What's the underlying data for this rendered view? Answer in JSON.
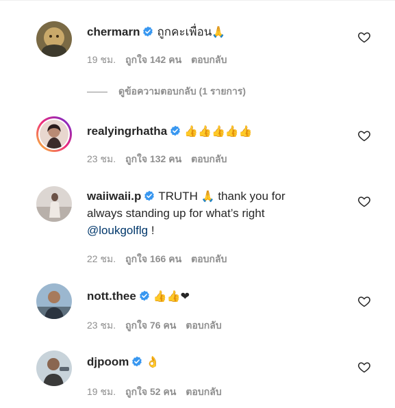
{
  "comments": [
    {
      "username": "chermarn",
      "text": "ถูกคะเพื่อน",
      "emoji": "🙏",
      "time": "19 ชม.",
      "likes": "ถูกใจ 142 คน",
      "reply": "ตอบกลับ"
    },
    {
      "username": "realyingrhatha",
      "text": "",
      "emoji": "👍👍👍👍👍",
      "time": "23 ชม.",
      "likes": "ถูกใจ 132 คน",
      "reply": "ตอบกลับ"
    },
    {
      "username": "waiiwaii.p",
      "text_a": "TRUTH",
      "emoji": "🙏",
      "text_b": "thank you for always standing up for what’s right",
      "mention": "@loukgolflg",
      "text_c": " !",
      "time": "22 ชม.",
      "likes": "ถูกใจ 166 คน",
      "reply": "ตอบกลับ"
    },
    {
      "username": "nott.thee",
      "text": "",
      "emoji": "👍👍❤",
      "time": "23 ชม.",
      "likes": "ถูกใจ 76 คน",
      "reply": "ตอบกลับ"
    },
    {
      "username": "djpoom",
      "text": "",
      "emoji": "👌",
      "time": "19 ชม.",
      "likes": "ถูกใจ 52 คน",
      "reply": "ตอบกลับ"
    }
  ],
  "view_replies_label": "ดูข้อความตอบกลับ (1 รายการ)",
  "icons": {
    "verified": "verified-badge-icon",
    "like": "heart-outline-icon"
  },
  "colors": {
    "verified_blue": "#3897f0",
    "meta_gray": "#8e8e8e",
    "mention_blue": "#00376b"
  }
}
